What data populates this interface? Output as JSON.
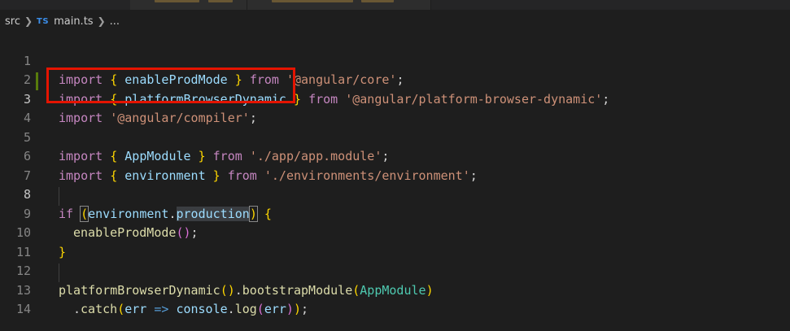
{
  "breadcrumb": {
    "folder": "src",
    "lang_badge": "TS",
    "file": "main.ts",
    "more": "..."
  },
  "code": {
    "lines": [
      {
        "n": "1"
      },
      {
        "n": "2"
      },
      {
        "n": "3"
      },
      {
        "n": "4"
      },
      {
        "n": "5"
      },
      {
        "n": "6"
      },
      {
        "n": "7"
      },
      {
        "n": "8"
      },
      {
        "n": "9"
      },
      {
        "n": "10"
      },
      {
        "n": "11"
      },
      {
        "n": "12"
      },
      {
        "n": "13"
      },
      {
        "n": "14"
      }
    ],
    "t": {
      "import": "import",
      "from": "from",
      "if": "if",
      "lbrace": "{",
      "rbrace": "}",
      "lparen": "(",
      "rparen": ")",
      "semi": ";",
      "dot": ".",
      "arrow": "=>",
      "enableProdMode": "enableProdMode",
      "platformBrowserDynamic": "platformBrowserDynamic",
      "AppModule": "AppModule",
      "environment": "environment",
      "production": "production",
      "bootstrapModule": "bootstrapModule",
      "catch": "catch",
      "err": "err",
      "console": "console",
      "log": "log",
      "s_core": "'@angular/core'",
      "s_pbd": "'@angular/platform-browser-dynamic'",
      "s_compiler": "'@angular/compiler'",
      "s_appmod": "'./app/app.module'",
      "s_env": "'./environments/environment'"
    }
  },
  "colors": {
    "background": "#1e1e1e",
    "keyword": "#c586c0",
    "string": "#ce9178",
    "identifier": "#9cdcfe",
    "function": "#dcdcaa",
    "class": "#4ec9b0",
    "highlight_box": "#e51400",
    "modified_gutter": "#587c0c"
  }
}
